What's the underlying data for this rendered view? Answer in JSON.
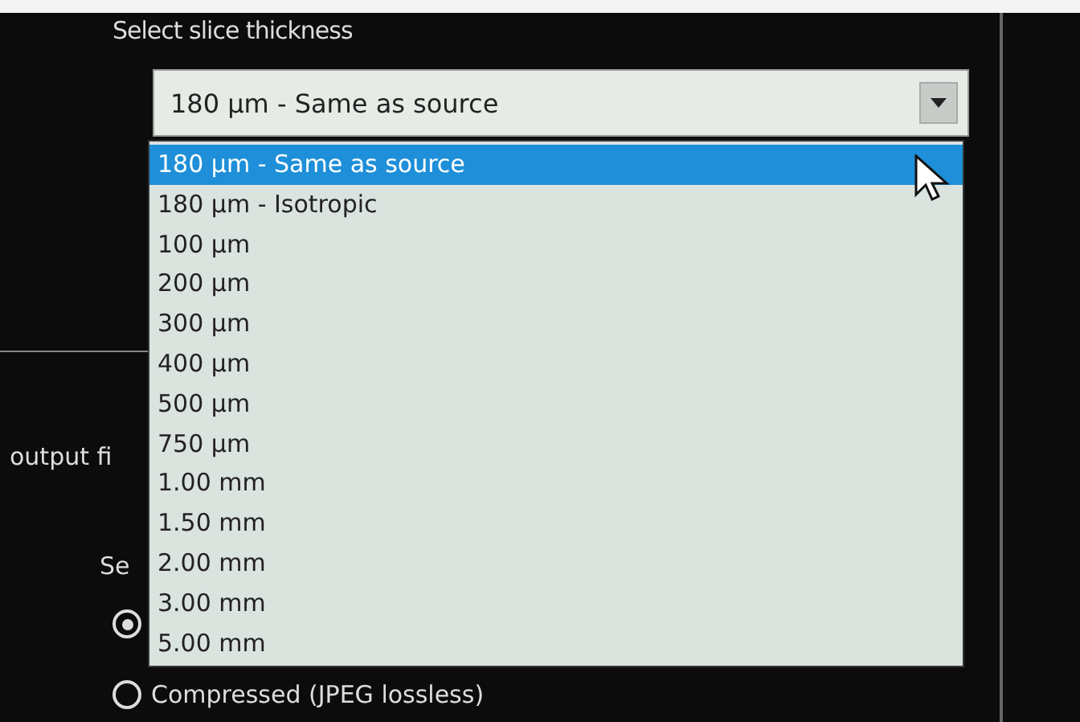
{
  "section_label": "Select slice thickness",
  "combo": {
    "value": "180 µm - Same as source",
    "expanded": true
  },
  "options": [
    {
      "label": "180 µm - Same as source",
      "selected": true
    },
    {
      "label": "180 µm - Isotropic",
      "selected": false
    },
    {
      "label": "100 µm",
      "selected": false
    },
    {
      "label": "200 µm",
      "selected": false
    },
    {
      "label": "300 µm",
      "selected": false
    },
    {
      "label": "400 µm",
      "selected": false
    },
    {
      "label": "500 µm",
      "selected": false
    },
    {
      "label": "750 µm",
      "selected": false
    },
    {
      "label": "1.00 mm",
      "selected": false
    },
    {
      "label": "1.50 mm",
      "selected": false
    },
    {
      "label": "2.00 mm",
      "selected": false
    },
    {
      "label": "3.00 mm",
      "selected": false
    },
    {
      "label": "5.00 mm",
      "selected": false
    }
  ],
  "behind": {
    "output_label": "output fi",
    "sub_label": "Se",
    "radios": [
      {
        "selected": true
      },
      {
        "label": "Compressed (JPEG lossless)",
        "selected": false
      }
    ]
  }
}
